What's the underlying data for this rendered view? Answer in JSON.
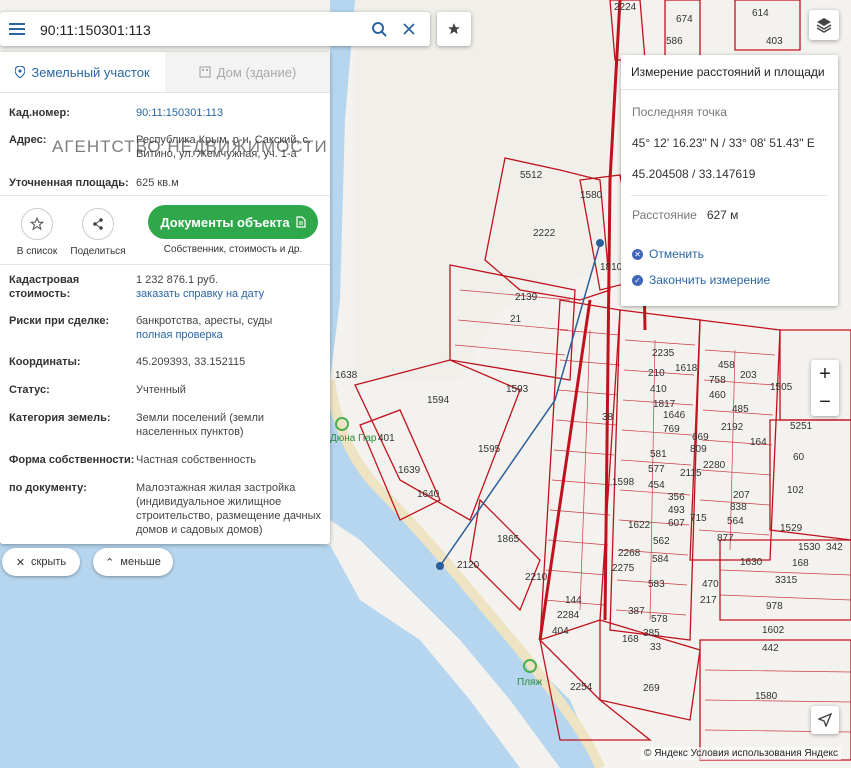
{
  "search": {
    "value": "90:11:150301:113"
  },
  "panel": {
    "tabs": [
      {
        "label": "Земельный участок"
      },
      {
        "label": "Дом (здание)"
      }
    ],
    "watermark": "АГЕНТСТВО НЕДВИЖИМОСТИ",
    "fields": {
      "cadnum_label": "Кад.номер:",
      "cadnum": "90:11:150301:113",
      "address_label": "Адрес:",
      "address": "Республика Крым, р-н. Сакский, с. Витино, ул. Жемчужная, уч. 1-а",
      "area_label": "Уточненная площадь:",
      "area": "625 кв.м",
      "cost_label": "Кадастровая стоимость:",
      "cost": "1 232 876.1 руб.",
      "cost_link": "заказать справку на дату",
      "risk_label": "Риски при сделке:",
      "risk": "банкротства, аресты, суды",
      "risk_link": "полная проверка",
      "coords_label": "Координаты:",
      "coords": "45.209393, 33.152115",
      "status_label": "Статус:",
      "status": "Учтенный",
      "category_label": "Категория земель:",
      "category": "Земли поселений (земли населенных пунктов)",
      "ownership_label": "Форма собственности:",
      "ownership": "Частная собственность",
      "bydoc_label": "по документу:",
      "bydoc": "Малоэтажная жилая застройка (индивидуальное жилищное строительство, размещение дачных домов и садовых домов)"
    },
    "actions": {
      "list": "В список",
      "share": "Поделиться",
      "docs": "Документы объекта",
      "docs_sub": "Собственник, стоимость и др."
    }
  },
  "pills": {
    "hide": "скрыть",
    "less": "меньше"
  },
  "measure": {
    "title": "Измерение расстояний и площади",
    "last_point_label": "Последняя точка",
    "dms": "45° 12' 16.23\" N / 33° 08' 51.43\" E",
    "decimal": "45.204508 / 33.147619",
    "distance_label": "Расстояние",
    "distance": "627 м",
    "cancel": "Отменить",
    "finish": "Закончить измерение"
  },
  "map_labels": {
    "parcels": [
      "2224",
      "674",
      "586",
      "614",
      "403",
      "5512",
      "1580",
      "2222",
      "1810",
      "2139",
      "21",
      "133",
      "1638",
      "1594",
      "1593",
      "1595",
      "1639",
      "1640",
      "1865",
      "2120",
      "2210",
      "144",
      "2284",
      "404",
      "2221",
      "2254",
      "269",
      "2235",
      "1618",
      "210",
      "410",
      "1817",
      "1646",
      "769",
      "458",
      "758",
      "460",
      "485",
      "203",
      "669",
      "809",
      "2192",
      "2280",
      "164",
      "1505",
      "581",
      "577",
      "2115",
      "1598",
      "454",
      "356",
      "493",
      "607",
      "715",
      "207",
      "838",
      "564",
      "1622",
      "562",
      "584",
      "2268",
      "2275",
      "583",
      "387",
      "578",
      "385",
      "168",
      "33",
      "470",
      "217",
      "877",
      "5251",
      "60",
      "102",
      "1529",
      "1530",
      "342",
      "1630",
      "168",
      "3315",
      "978",
      "1602",
      "442",
      "1580",
      "38"
    ],
    "pois": [
      "Дюна Пар 401",
      "Пляж"
    ]
  },
  "attribution": "© Яндекс Условия использования Яндекс",
  "colors": {
    "parcel": "#c0121e",
    "sea": "#b6d6ef",
    "land": "#f4f2ee",
    "accent": "#2a66a3",
    "green": "#2ea84a"
  }
}
